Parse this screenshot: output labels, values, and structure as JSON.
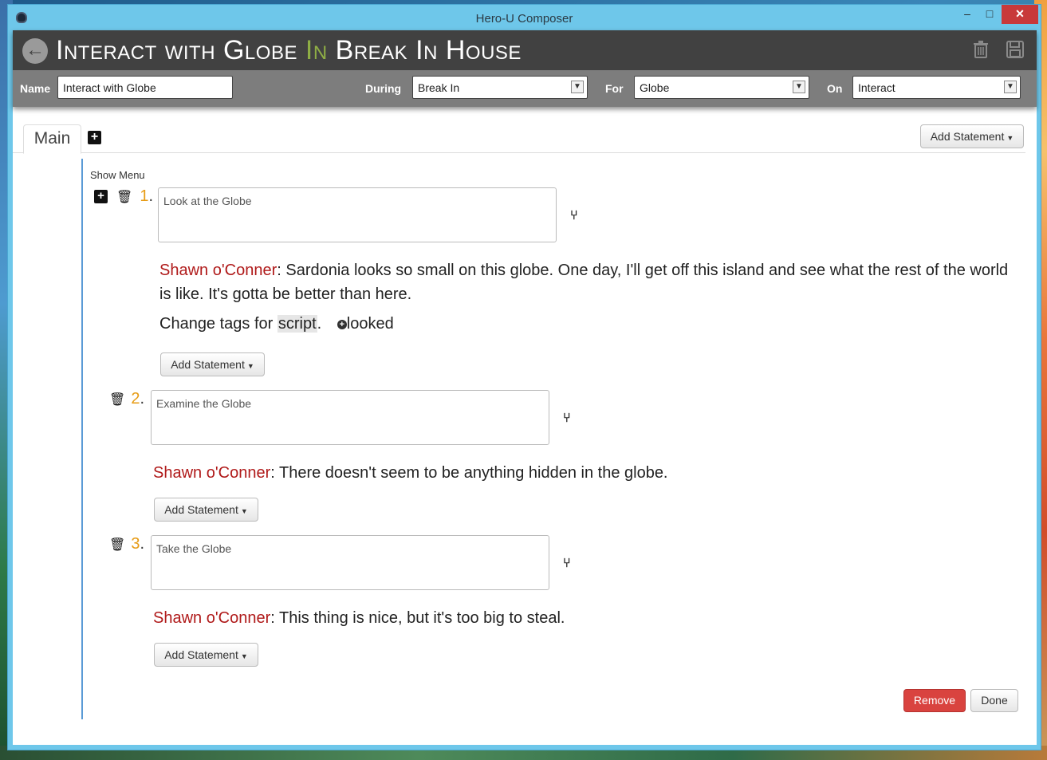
{
  "window": {
    "title": "Hero-U Composer",
    "minimize": "–",
    "maximize": "□",
    "close": "✕"
  },
  "header": {
    "title_part1": "Interact with Globe",
    "title_in": "In",
    "title_part2": "Break In House",
    "name_label": "Name",
    "name_value": "Interact with Globe",
    "during_label": "During",
    "during_value": "Break In",
    "for_label": "For",
    "for_value": "Globe",
    "on_label": "On",
    "on_value": "Interact"
  },
  "tabs": {
    "main": "Main",
    "add_statement": "Add Statement"
  },
  "show_menu": "Show Menu",
  "statements": [
    {
      "number": "1",
      "text": "Look at the Globe",
      "speaker": "Shawn o'Conner",
      "line": ": Sardonia looks so small on this globe. One day, I'll get off this island and see what the rest of the world is like. It's gotta be better than here.",
      "tag_prefix": "Change tags for ",
      "tag_target": "script",
      "tag_suffix": ".",
      "tag_name": "looked",
      "add_statement": "Add Statement"
    },
    {
      "number": "2",
      "text": "Examine the Globe",
      "speaker": "Shawn o'Conner",
      "line": ": There doesn't seem to be anything hidden in the globe.",
      "add_statement": "Add Statement"
    },
    {
      "number": "3",
      "text": "Take the Globe",
      "speaker": "Shawn o'Conner",
      "line": ": This thing is nice, but it's too big to steal.",
      "add_statement": "Add Statement"
    }
  ],
  "footer": {
    "remove": "Remove",
    "done": "Done"
  },
  "colors": {
    "accent": "#5a9bd6",
    "speaker": "#b01a1a",
    "number": "#e79b14",
    "remove": "#d9433f",
    "title_in": "#8fae45"
  }
}
